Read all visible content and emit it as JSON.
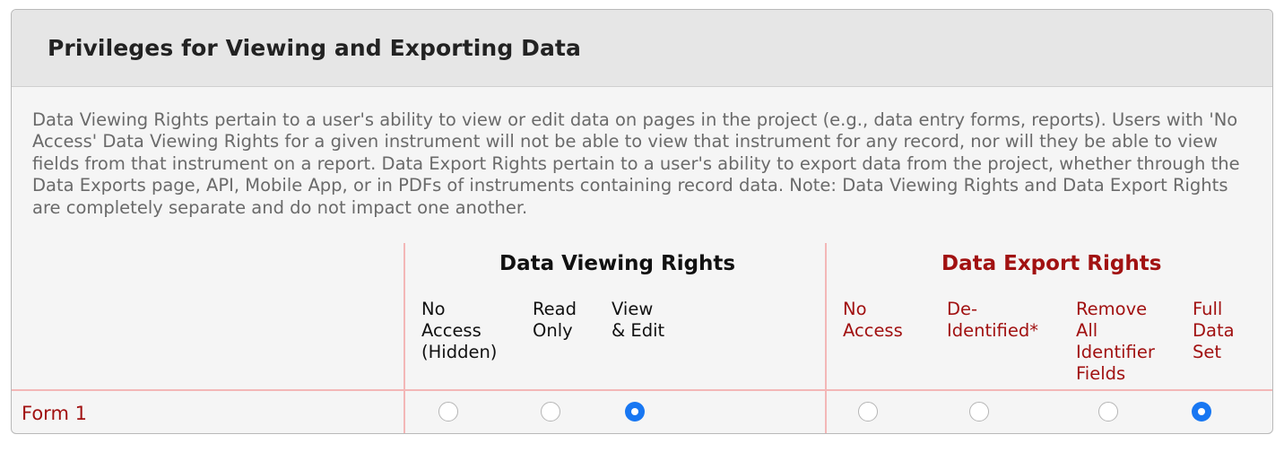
{
  "panel": {
    "title": "Privileges for Viewing and Exporting Data",
    "description": "Data Viewing Rights pertain to a user's ability to view or edit data on pages in the project (e.g., data entry forms, reports). Users with 'No Access' Data Viewing Rights for a given instrument will not be able to view that instrument for any record, nor will they be able to view fields from that instrument on a report. Data Export Rights pertain to a user's ability to export data from the project, whether through the Data Exports page, API, Mobile App, or in PDFs of instruments containing record data. Note: Data Viewing Rights and Data Export Rights are completely separate and do not impact one another."
  },
  "viewing": {
    "heading": "Data Viewing Rights",
    "columns": [
      {
        "line1": "No",
        "line2": "Access",
        "line3": "(Hidden)"
      },
      {
        "line1": "Read",
        "line2": "Only"
      },
      {
        "line1": "View",
        "line2": "& Edit"
      }
    ]
  },
  "export": {
    "heading": "Data Export Rights",
    "columns": [
      {
        "line1": "No",
        "line2": "Access"
      },
      {
        "line1": "De-",
        "line2": "Identified*"
      },
      {
        "line1": "Remove",
        "line2": "All",
        "line3": "Identifier",
        "line4": "Fields"
      },
      {
        "line1": "Full",
        "line2": "Data",
        "line3": "Set"
      }
    ]
  },
  "rows": [
    {
      "label": "Form 1",
      "viewing_selected": "View & Edit",
      "export_selected": "Full Data Set"
    }
  ],
  "colors": {
    "accent_red": "#a11111",
    "divider_pink": "#f3b7b7",
    "radio_selected": "#1877f2"
  },
  "icons": [
    "radio-unchecked-icon",
    "radio-checked-icon"
  ]
}
